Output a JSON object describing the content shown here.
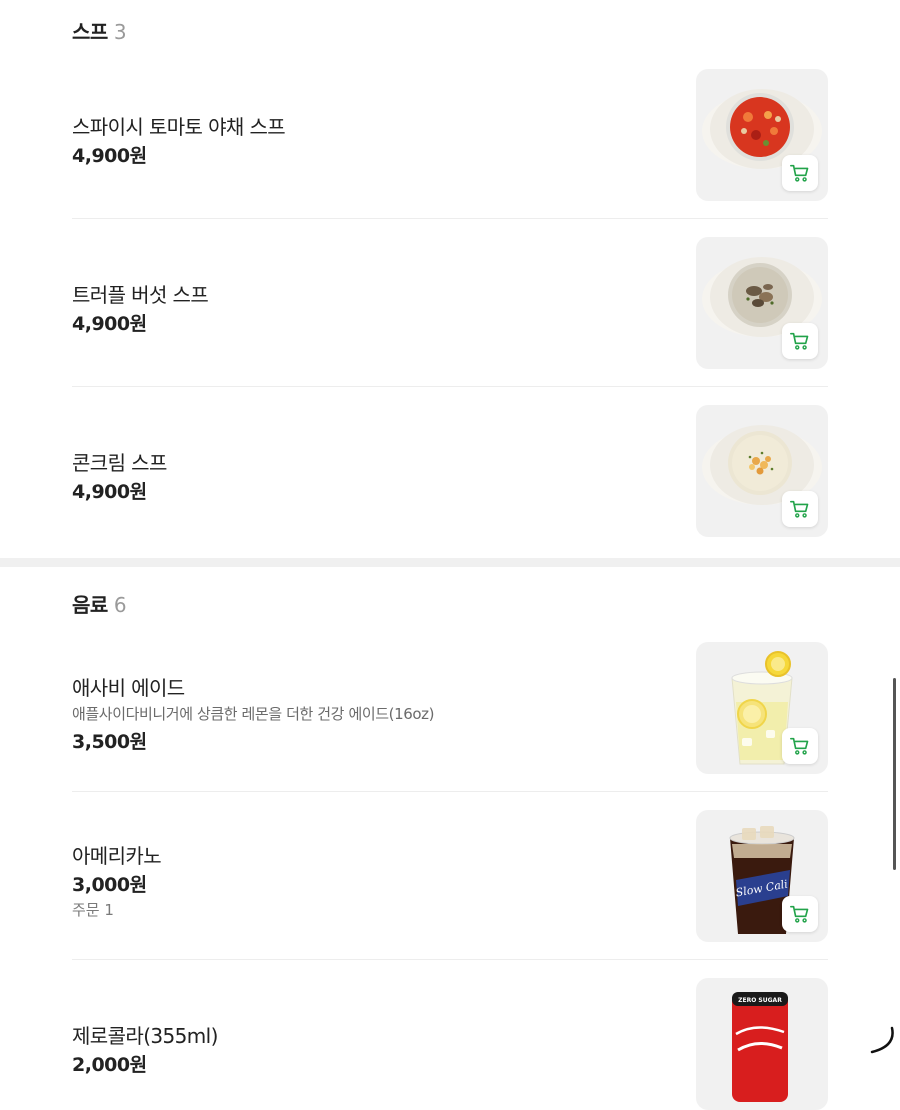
{
  "sections": [
    {
      "title": "스프",
      "count": "3",
      "items": [
        {
          "name": "스파이시 토마토 야채 스프",
          "price": "4,900원",
          "image_icon": "tomato-soup-image"
        },
        {
          "name": "트러플 버섯 스프",
          "price": "4,900원",
          "image_icon": "mushroom-soup-image"
        },
        {
          "name": "콘크림 스프",
          "price": "4,900원",
          "image_icon": "corn-soup-image"
        }
      ]
    },
    {
      "title": "음료",
      "count": "6",
      "items": [
        {
          "name": "애사비 에이드",
          "description": "애플사이다비니거에 상큼한 레몬을 더한 건강 에이드(16oz)",
          "price": "3,500원",
          "image_icon": "lemon-ade-image"
        },
        {
          "name": "아메리카노",
          "price": "3,000원",
          "order_count": "주문 1",
          "image_icon": "iced-americano-image",
          "cup_text": "Slow Cali"
        },
        {
          "name": "제로콜라(355ml)",
          "price": "2,000원",
          "image_icon": "cola-can-image",
          "can_text": "ZERO SUGAR"
        }
      ]
    }
  ],
  "icons": {
    "cart": "cart-icon",
    "loading": "loading-spinner-icon"
  },
  "colors": {
    "accent": "#22a34a",
    "divider": "#ededed",
    "section_gap": "#f0f0f0",
    "thumb_bg": "#f1f1f1"
  }
}
